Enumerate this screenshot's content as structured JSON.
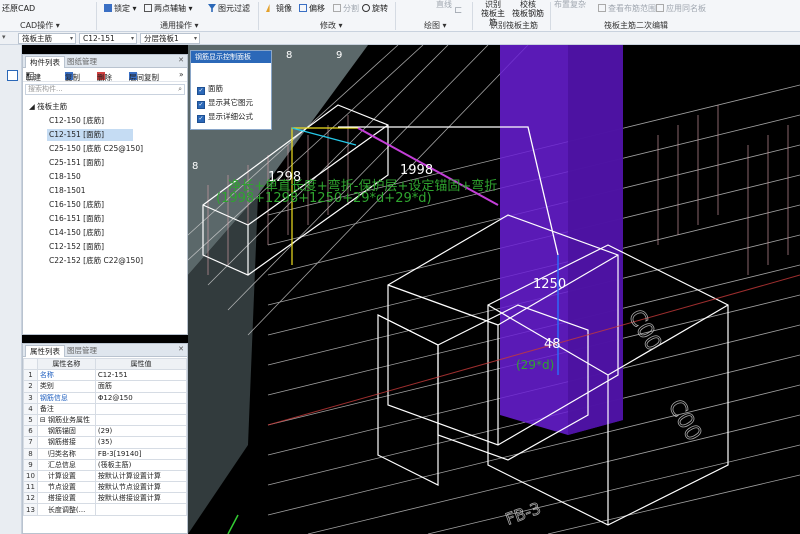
{
  "ribbon": {
    "restore_cad": "还原CAD",
    "cad_ops": "CAD操作",
    "lock": "锁定",
    "two_point_axis": "两点辅轴",
    "filter": "图元过滤",
    "common_ops": "通用操作",
    "mirror": "镜像",
    "offset": "偏移",
    "split": "分割",
    "rotate": "旋转",
    "modify": "修改",
    "straight": "直线",
    "draw": "绘图",
    "identify_main": "识别\n筏板主筋",
    "verify_main": "校核\n筏板钢筋",
    "identify_group": "识别筏板主筋",
    "layout_range": "布置复杂",
    "view_layout_range": "查看布筋范围",
    "apply_same_name": "应用同名板",
    "secondary_edit": "筏板主筋二次编辑"
  },
  "toolbar": {
    "category": "筏板主筋",
    "component": "C12-151",
    "layer": "分层筏板1"
  },
  "component_panel": {
    "tab_active": "构件列表",
    "tab_inactive": "图纸管理",
    "new": "新建",
    "copy": "复制",
    "delete": "删除",
    "layer_copy": "层间复制",
    "search_placeholder": "搜索构件...",
    "root": "筏板主筋",
    "items": [
      "C12-150 [底筋]",
      "C12-151 [面筋]",
      "C25-150 [底筋 C25@150]",
      "C25-151 [面筋]",
      "C18-150",
      "C18-1501",
      "C16-150 [底筋]",
      "C16-151 [面筋]",
      "C14-150 [底筋]",
      "C12-152 [面筋]",
      "C22-152 [底筋 C22@150]"
    ]
  },
  "property_panel": {
    "tab_active": "属性列表",
    "tab_inactive": "图层管理",
    "col_name": "属性名称",
    "col_value": "属性值",
    "rows": [
      {
        "n": "1",
        "name": "名称",
        "value": "C12-151",
        "blue": true
      },
      {
        "n": "2",
        "name": "类别",
        "value": "面筋",
        "blue": false
      },
      {
        "n": "3",
        "name": "钢筋信息",
        "value": "Φ12@150",
        "blue": true
      },
      {
        "n": "4",
        "name": "备注",
        "value": "",
        "blue": false
      },
      {
        "n": "5",
        "name": "⊟ 钢筋业务属性",
        "value": "",
        "blue": false
      },
      {
        "n": "6",
        "name": "钢筋锚固",
        "value": "(29)",
        "blue": false
      },
      {
        "n": "7",
        "name": "钢筋搭接",
        "value": "(35)",
        "blue": false
      },
      {
        "n": "8",
        "name": "归类名称",
        "value": "FB-3[19140]",
        "blue": false
      },
      {
        "n": "9",
        "name": "汇总信息",
        "value": "(筏板主筋)",
        "blue": false
      },
      {
        "n": "10",
        "name": "计算设置",
        "value": "按默认计算设置计算",
        "blue": false
      },
      {
        "n": "11",
        "name": "节点设置",
        "value": "按默认节点设置计算",
        "blue": false
      },
      {
        "n": "12",
        "name": "搭接设置",
        "value": "按默认搭接设置计算",
        "blue": false
      },
      {
        "n": "13",
        "name": "长度调整(...",
        "value": "",
        "blue": false
      }
    ]
  },
  "control_panel": {
    "title": "钢筋显示控制面板",
    "options": [
      "面筋",
      "显示其它图元",
      "显示详细公式"
    ]
  },
  "viewport": {
    "dim_1998": "1998",
    "dim_1298": "1298",
    "dim_1250": "1250",
    "dim_48": "48",
    "label_29d": "(29*d)",
    "formula_cn": "净长+单直长度+弯折-保护层+设定锚固+弯折",
    "formula_calc": "(1998+1298+1250+29*d+29*d)",
    "grid_8a": "8",
    "grid_8b": "8",
    "grid_9": "9"
  }
}
